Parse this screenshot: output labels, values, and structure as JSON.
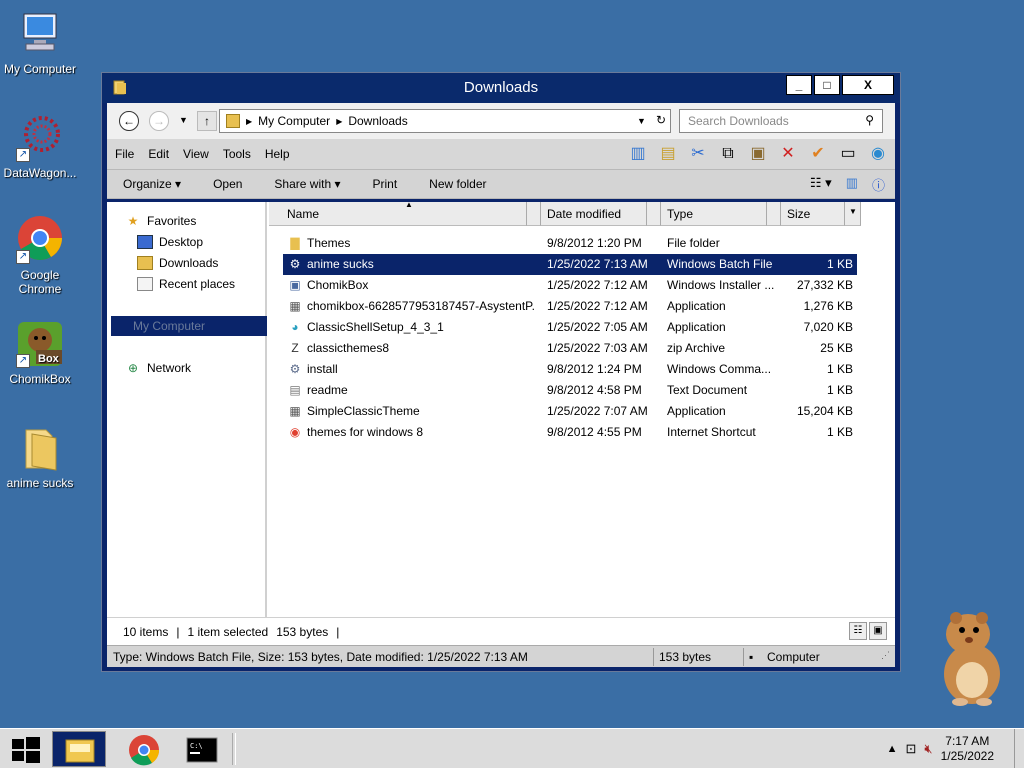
{
  "desktop": {
    "icons": [
      {
        "label": "My Computer"
      },
      {
        "label": "DataWagon..."
      },
      {
        "label": "Google Chrome"
      },
      {
        "label": "ChomikBox"
      },
      {
        "label": "anime sucks"
      }
    ]
  },
  "window": {
    "title": "Downloads",
    "buttons": {
      "minimize": "_",
      "maximize": "□",
      "close": "X"
    }
  },
  "address": {
    "crumbs": [
      "My Computer",
      "Downloads"
    ],
    "search_placeholder": "Search Downloads"
  },
  "menu": [
    "File",
    "Edit",
    "View",
    "Tools",
    "Help"
  ],
  "commands": [
    "Organize ▾",
    "Open",
    "Share with ▾",
    "Print",
    "New folder"
  ],
  "nav": {
    "favorites": "Favorites",
    "desktop": "Desktop",
    "downloads": "Downloads",
    "recent": "Recent places",
    "my_computer": "My Computer",
    "network": "Network"
  },
  "columns": {
    "name": "Name",
    "date": "Date modified",
    "type": "Type",
    "size": "Size"
  },
  "files": [
    {
      "name": "Themes",
      "date": "9/8/2012 1:20 PM",
      "type": "File folder",
      "size": "",
      "icon": "folder-icon"
    },
    {
      "name": "anime sucks",
      "date": "1/25/2022 7:13 AM",
      "type": "Windows Batch File",
      "size": "1 KB",
      "icon": "batch-file-icon"
    },
    {
      "name": "ChomikBox",
      "date": "1/25/2022 7:12 AM",
      "type": "Windows Installer ...",
      "size": "27,332 KB",
      "icon": "installer-icon"
    },
    {
      "name": "chomikbox-6628577953187457-AsystentP...",
      "date": "1/25/2022 7:12 AM",
      "type": "Application",
      "size": "1,276 KB",
      "icon": "application-icon"
    },
    {
      "name": "ClassicShellSetup_4_3_1",
      "date": "1/25/2022 7:05 AM",
      "type": "Application",
      "size": "7,020 KB",
      "icon": "shell-icon"
    },
    {
      "name": "classicthemes8",
      "date": "1/25/2022 7:03 AM",
      "type": "zip Archive",
      "size": "25 KB",
      "icon": "zip-icon"
    },
    {
      "name": "install",
      "date": "9/8/2012 1:24 PM",
      "type": "Windows Comma...",
      "size": "1 KB",
      "icon": "command-file-icon"
    },
    {
      "name": "readme",
      "date": "9/8/2012 4:58 PM",
      "type": "Text Document",
      "size": "1 KB",
      "icon": "text-file-icon"
    },
    {
      "name": "SimpleClassicTheme",
      "date": "1/25/2022 7:07 AM",
      "type": "Application",
      "size": "15,204 KB",
      "icon": "application-icon"
    },
    {
      "name": "themes for windows 8",
      "date": "9/8/2012 4:55 PM",
      "type": "Internet Shortcut",
      "size": "1 KB",
      "icon": "internet-shortcut-icon"
    }
  ],
  "status": {
    "items": "10 items",
    "selected": "1 item selected",
    "bytes": "153 bytes",
    "detail": "Type: Windows Batch File, Size: 153 bytes, Date modified: 1/25/2022 7:13 AM",
    "size": "153 bytes",
    "location": "Computer"
  },
  "taskbar": {
    "time": "7:17 AM",
    "date": "1/25/2022"
  },
  "colors": {
    "desktop": "#3a6ea5",
    "selection": "#0a246a"
  }
}
